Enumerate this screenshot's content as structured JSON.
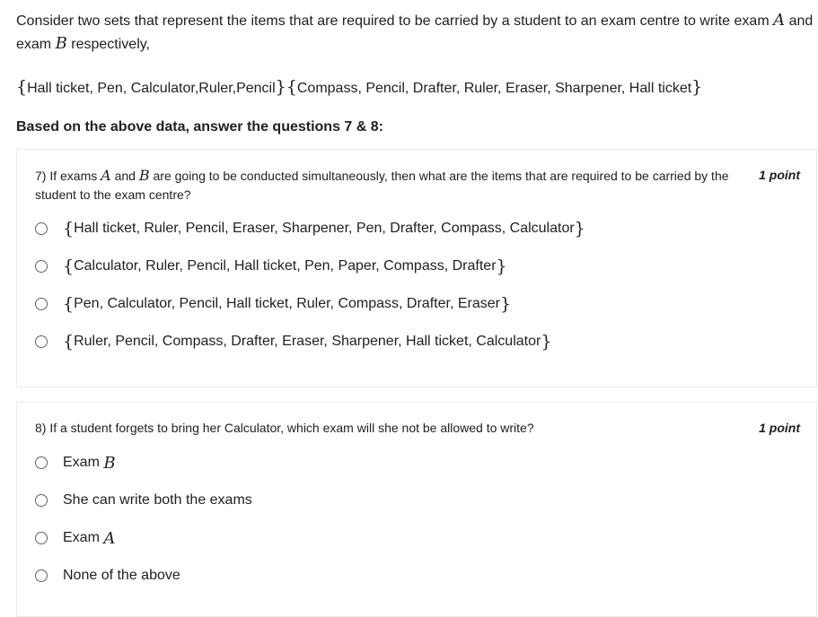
{
  "intro": {
    "text_before_a": "Consider two sets that represent the items that are required to be carried by a student to an exam centre to write exam",
    "var_a": "A",
    "text_and": "and",
    "text_exam": "exam",
    "var_b": "B",
    "text_after_b": "respectively,"
  },
  "sets": {
    "set_a": "Hall ticket, Pen, Calculator,Ruler,Pencil",
    "set_b": "Compass, Pencil, Drafter, Ruler, Eraser, Sharpener, Hall ticket"
  },
  "based_on": "Based on the above data, answer the questions 7 & 8:",
  "questions": [
    {
      "prefix": "7) If exams",
      "var_a": "A",
      "mid": "and",
      "var_b": "B",
      "suffix": "are going to be conducted simultaneously, then what are the items that are required to be carried by the student to the exam centre?",
      "points": "1 point",
      "options": [
        "Hall ticket, Ruler, Pencil, Eraser, Sharpener, Pen, Drafter, Compass, Calculator",
        "Calculator, Ruler, Pencil, Hall ticket, Pen, Paper, Compass, Drafter",
        "Pen, Calculator, Pencil, Hall ticket, Ruler, Compass, Drafter, Eraser",
        "Ruler, Pencil, Compass, Drafter, Eraser, Sharpener, Hall ticket, Calculator"
      ]
    },
    {
      "text": "8) If a student forgets to bring her Calculator, which exam will she not be allowed to write?",
      "points": "1 point",
      "options": [
        {
          "label": "Exam",
          "var": "B"
        },
        {
          "label": "She can write both the exams",
          "var": ""
        },
        {
          "label": "Exam",
          "var": "A"
        },
        {
          "label": "None of the above",
          "var": ""
        }
      ]
    }
  ],
  "brace_open": "{",
  "brace_close": "}"
}
